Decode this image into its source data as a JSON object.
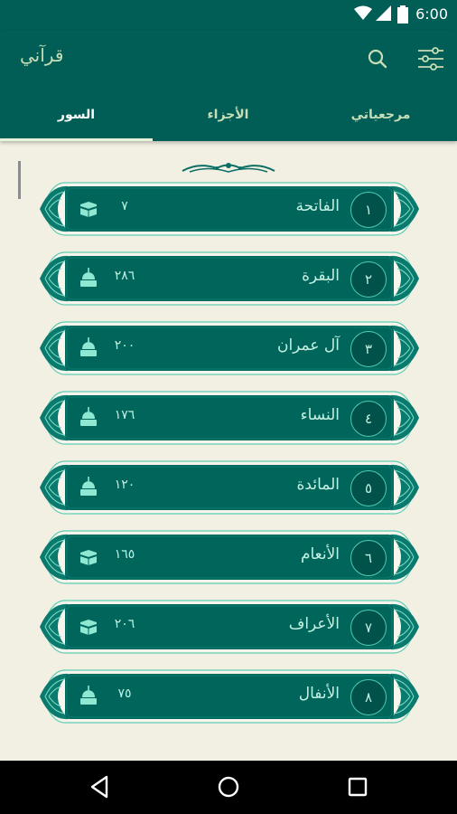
{
  "status_bar": {
    "time": "6:00",
    "icons": [
      "wifi-icon",
      "signal-icon",
      "battery-icon"
    ]
  },
  "app_bar": {
    "title": "قرآني",
    "icons": [
      "search-icon",
      "filter-settings-icon"
    ]
  },
  "tabs": [
    {
      "label": "مرجعياتي",
      "active": false
    },
    {
      "label": "الأجزاء",
      "active": false
    },
    {
      "label": "السور",
      "active": true
    }
  ],
  "suras": [
    {
      "number": "١",
      "name": "الفاتحة",
      "verses": "٧",
      "revelation": "kaaba-icon"
    },
    {
      "number": "٢",
      "name": "البقرة",
      "verses": "٢٨٦",
      "revelation": "mosque-icon"
    },
    {
      "number": "٣",
      "name": "آل عمران",
      "verses": "٢٠٠",
      "revelation": "mosque-icon"
    },
    {
      "number": "٤",
      "name": "النساء",
      "verses": "١٧٦",
      "revelation": "mosque-icon"
    },
    {
      "number": "٥",
      "name": "المائدة",
      "verses": "١٢٠",
      "revelation": "mosque-icon"
    },
    {
      "number": "٦",
      "name": "الأنعام",
      "verses": "١٦٥",
      "revelation": "kaaba-icon"
    },
    {
      "number": "٧",
      "name": "الأعراف",
      "verses": "٢٠٦",
      "revelation": "kaaba-icon"
    },
    {
      "number": "٨",
      "name": "الأنفال",
      "verses": "٧٥",
      "revelation": "mosque-icon"
    }
  ],
  "colors": {
    "primary": "#005e56",
    "card": "#00665c",
    "accent": "#4fc9b0",
    "background": "#f2efe3"
  },
  "nav_bar": {
    "icons": [
      "back-icon",
      "home-icon",
      "recents-icon"
    ]
  }
}
